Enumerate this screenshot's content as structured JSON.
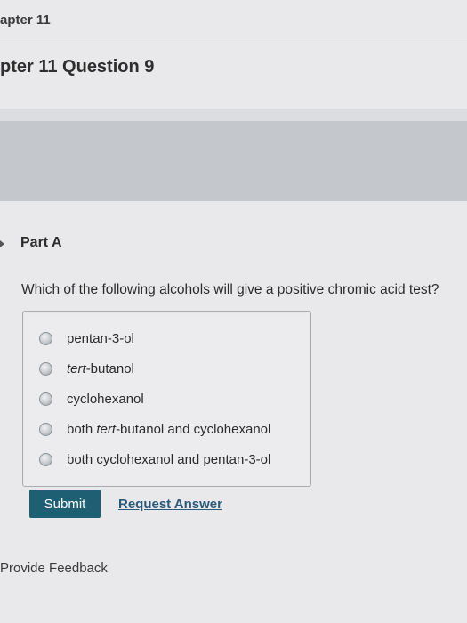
{
  "header": {
    "breadcrumb": "apter 11",
    "title": "pter 11 Question 9"
  },
  "part": {
    "label": "Part A",
    "question": "Which of the following alcohols will give a positive chromic acid test?"
  },
  "options": [
    {
      "pre": "pentan-3-ol",
      "em": "",
      "post": ""
    },
    {
      "pre": "",
      "em": "tert",
      "post": "-butanol"
    },
    {
      "pre": "cyclohexanol",
      "em": "",
      "post": ""
    },
    {
      "pre": "both ",
      "em": "tert",
      "post": "-butanol and cyclohexanol"
    },
    {
      "pre": "both cyclohexanol and pentan-3-ol",
      "em": "",
      "post": ""
    }
  ],
  "actions": {
    "submit_label": "Submit",
    "request_answer_label": "Request Answer"
  },
  "footer": {
    "feedback_label": "Provide Feedback"
  },
  "colors": {
    "submit_bg": "#1f5f73",
    "link": "#2a5a7a",
    "gray_band": "#c4c7cb"
  }
}
